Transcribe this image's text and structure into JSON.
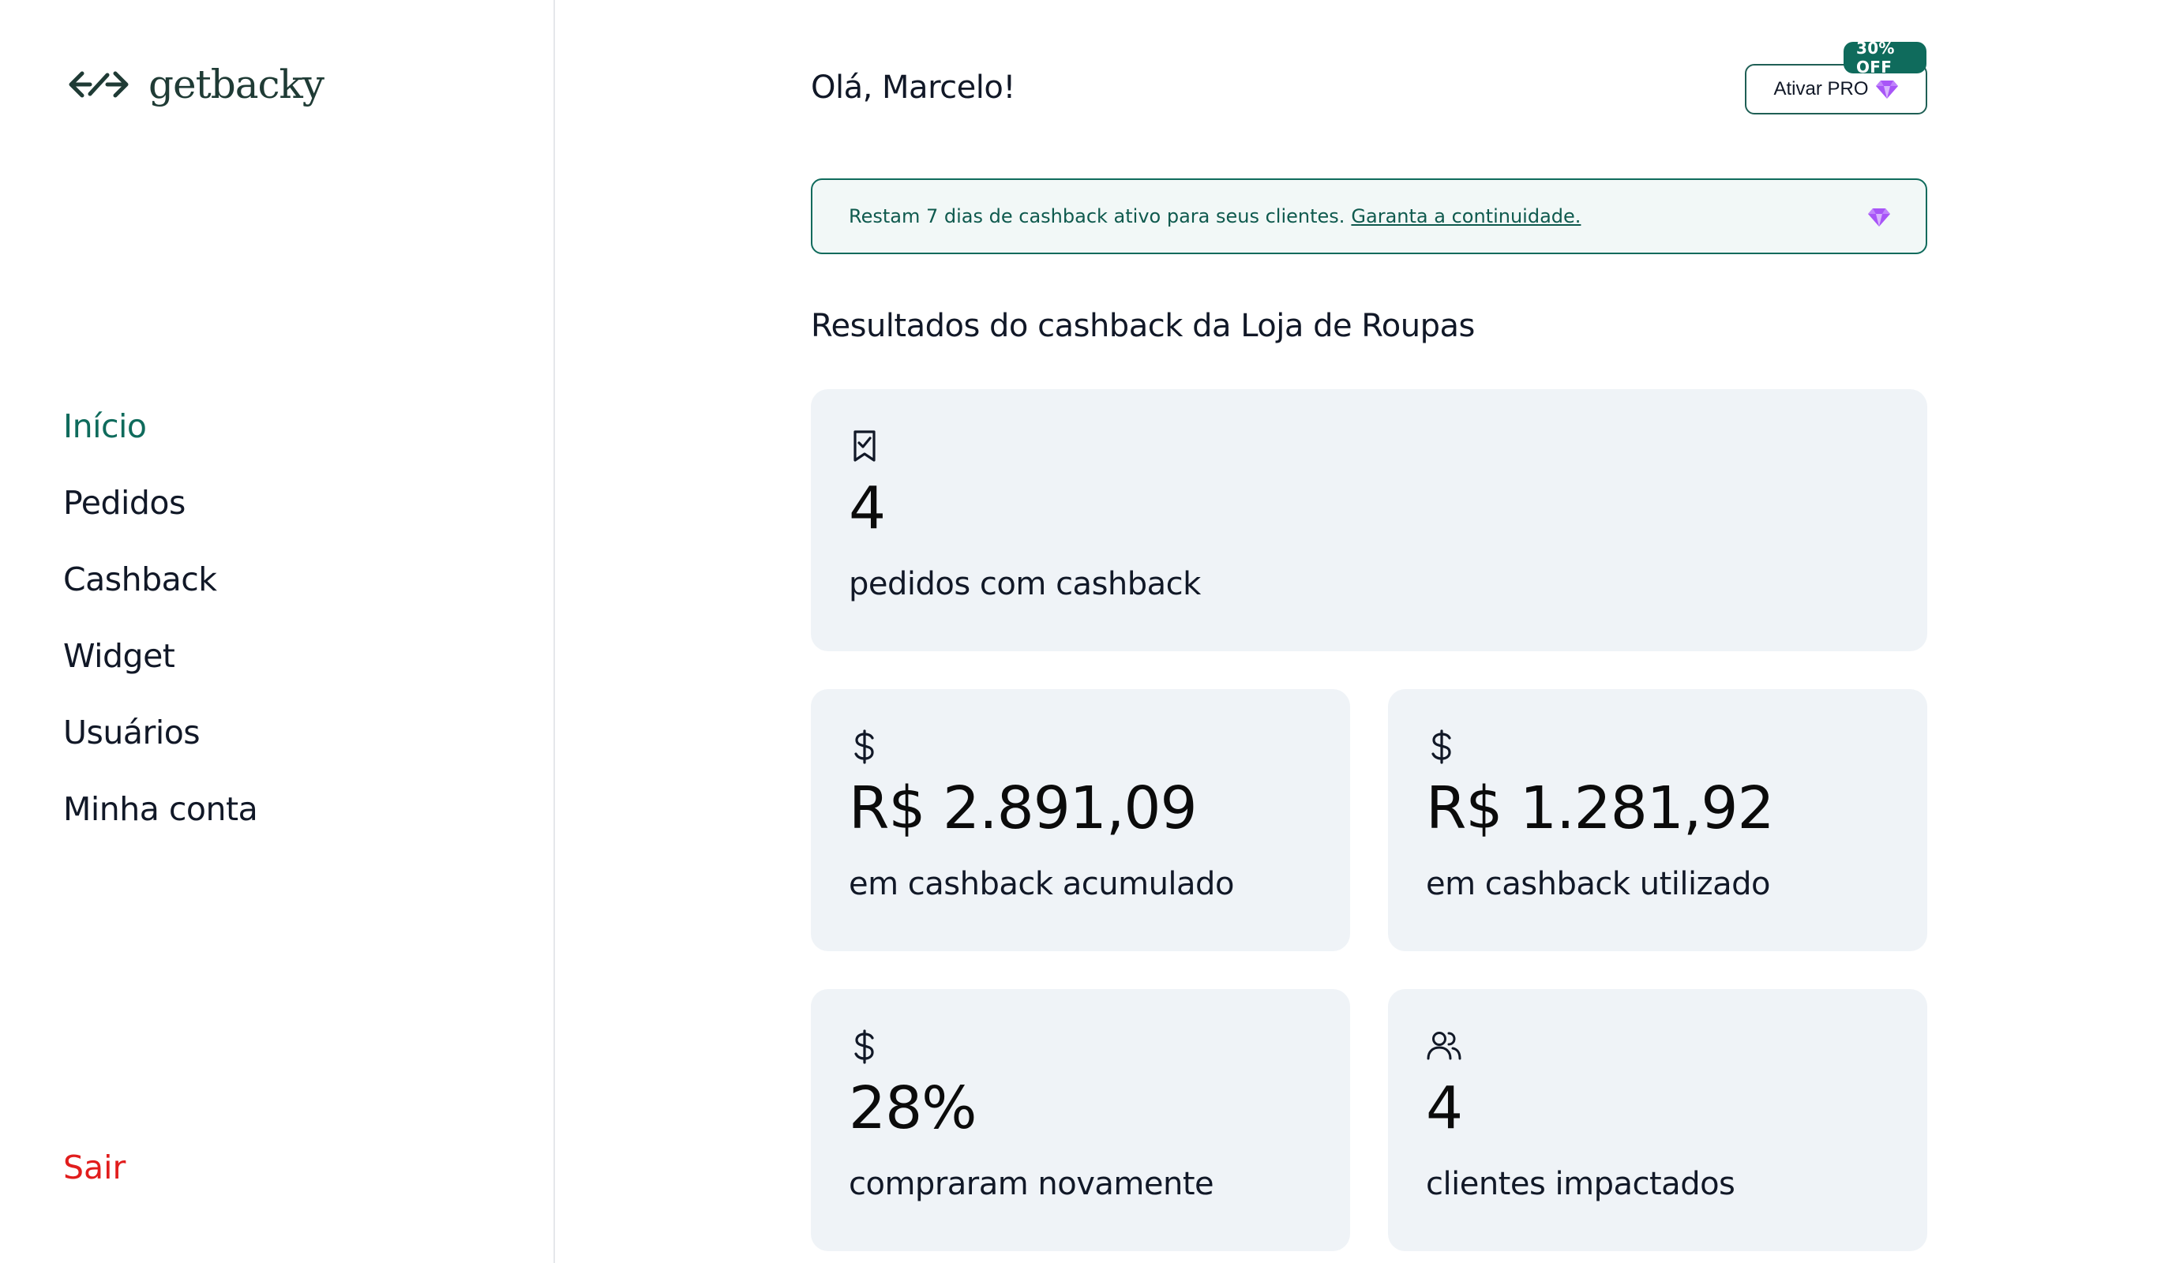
{
  "brand": {
    "name": "getbacky",
    "logo_icon": "arrows-logo-icon"
  },
  "sidebar": {
    "items": [
      {
        "label": "Início",
        "active": true
      },
      {
        "label": "Pedidos",
        "active": false
      },
      {
        "label": "Cashback",
        "active": false
      },
      {
        "label": "Widget",
        "active": false
      },
      {
        "label": "Usuários",
        "active": false
      },
      {
        "label": "Minha conta",
        "active": false
      }
    ],
    "logout_label": "Sair"
  },
  "header": {
    "greeting": "Olá, Marcelo!",
    "pro_button_label": "Ativar PRO",
    "pro_badge": "30% OFF"
  },
  "banner": {
    "text": "Restam 7 dias de cashback ativo para seus clientes.",
    "link_text": "Garanta a continuidade."
  },
  "section_title": "Resultados do cashback da Loja de Roupas",
  "stats": {
    "orders": {
      "icon": "receipt-check-icon",
      "value": "4",
      "label": "pedidos com cashback"
    },
    "accumulated": {
      "icon": "dollar-icon",
      "value": "R$ 2.891,09",
      "label": "em cashback acumulado"
    },
    "used": {
      "icon": "dollar-icon",
      "value": "R$ 1.281,92",
      "label": "em cashback utilizado"
    },
    "returning": {
      "icon": "dollar-icon",
      "value": "28%",
      "label": "compraram novamente"
    },
    "customers": {
      "icon": "users-icon",
      "value": "4",
      "label": "clientes impactados"
    }
  },
  "colors": {
    "accent": "#0f6b5c",
    "danger": "#e11d1d",
    "card_bg": "#eff3f7",
    "gem": "#a855f7"
  }
}
